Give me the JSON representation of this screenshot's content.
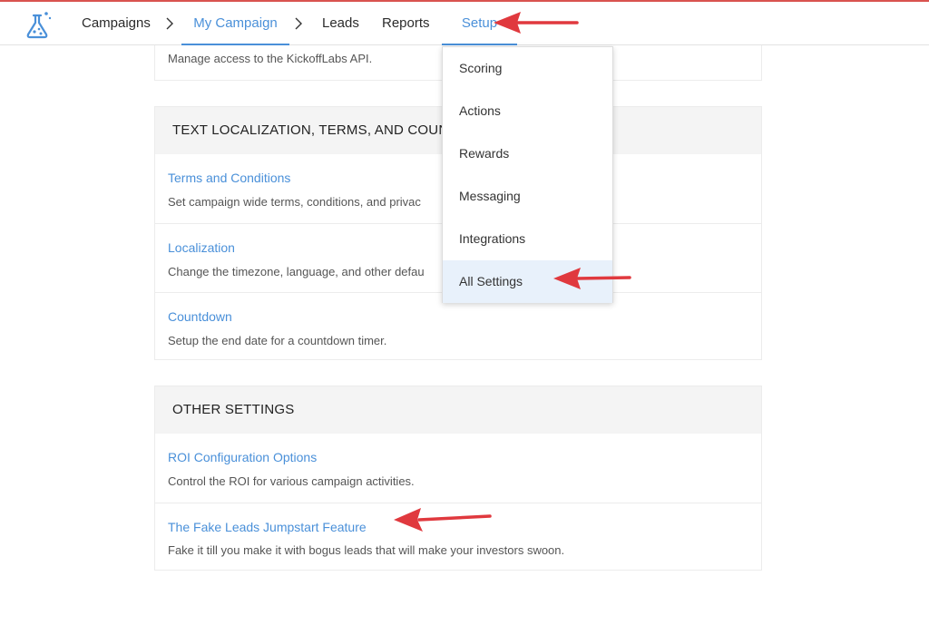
{
  "nav": {
    "items": [
      {
        "label": "Campaigns"
      },
      {
        "label": "My Campaign"
      },
      {
        "label": "Leads"
      },
      {
        "label": "Reports"
      },
      {
        "label": "Setup"
      }
    ]
  },
  "api_section": {
    "description": "Manage access to the KickoffLabs API."
  },
  "localization_section": {
    "header": "TEXT LOCALIZATION, TERMS, AND COUNT",
    "rows": [
      {
        "title": "Terms and Conditions",
        "description": "Set campaign wide terms, conditions, and privac"
      },
      {
        "title": "Localization",
        "description": "Change the timezone, language, and other defau"
      },
      {
        "title": "Countdown",
        "description": "Setup the end date for a countdown timer."
      }
    ]
  },
  "other_section": {
    "header": "OTHER SETTINGS",
    "rows": [
      {
        "title": "ROI Configuration Options",
        "description": "Control the ROI for various campaign activities."
      },
      {
        "title": "The Fake Leads Jumpstart Feature",
        "description": "Fake it till you make it with bogus leads that will make your investors swoon."
      }
    ]
  },
  "setup_menu": {
    "items": [
      {
        "label": "Scoring"
      },
      {
        "label": "Actions"
      },
      {
        "label": "Rewards"
      },
      {
        "label": "Messaging"
      },
      {
        "label": "Integrations"
      },
      {
        "label": "All Settings"
      }
    ]
  },
  "colors": {
    "accent": "#4a90d9",
    "annotation_arrow": "#e0393e",
    "header_bg": "#f4f4f4",
    "highlight_bg": "#e8f1fb"
  }
}
